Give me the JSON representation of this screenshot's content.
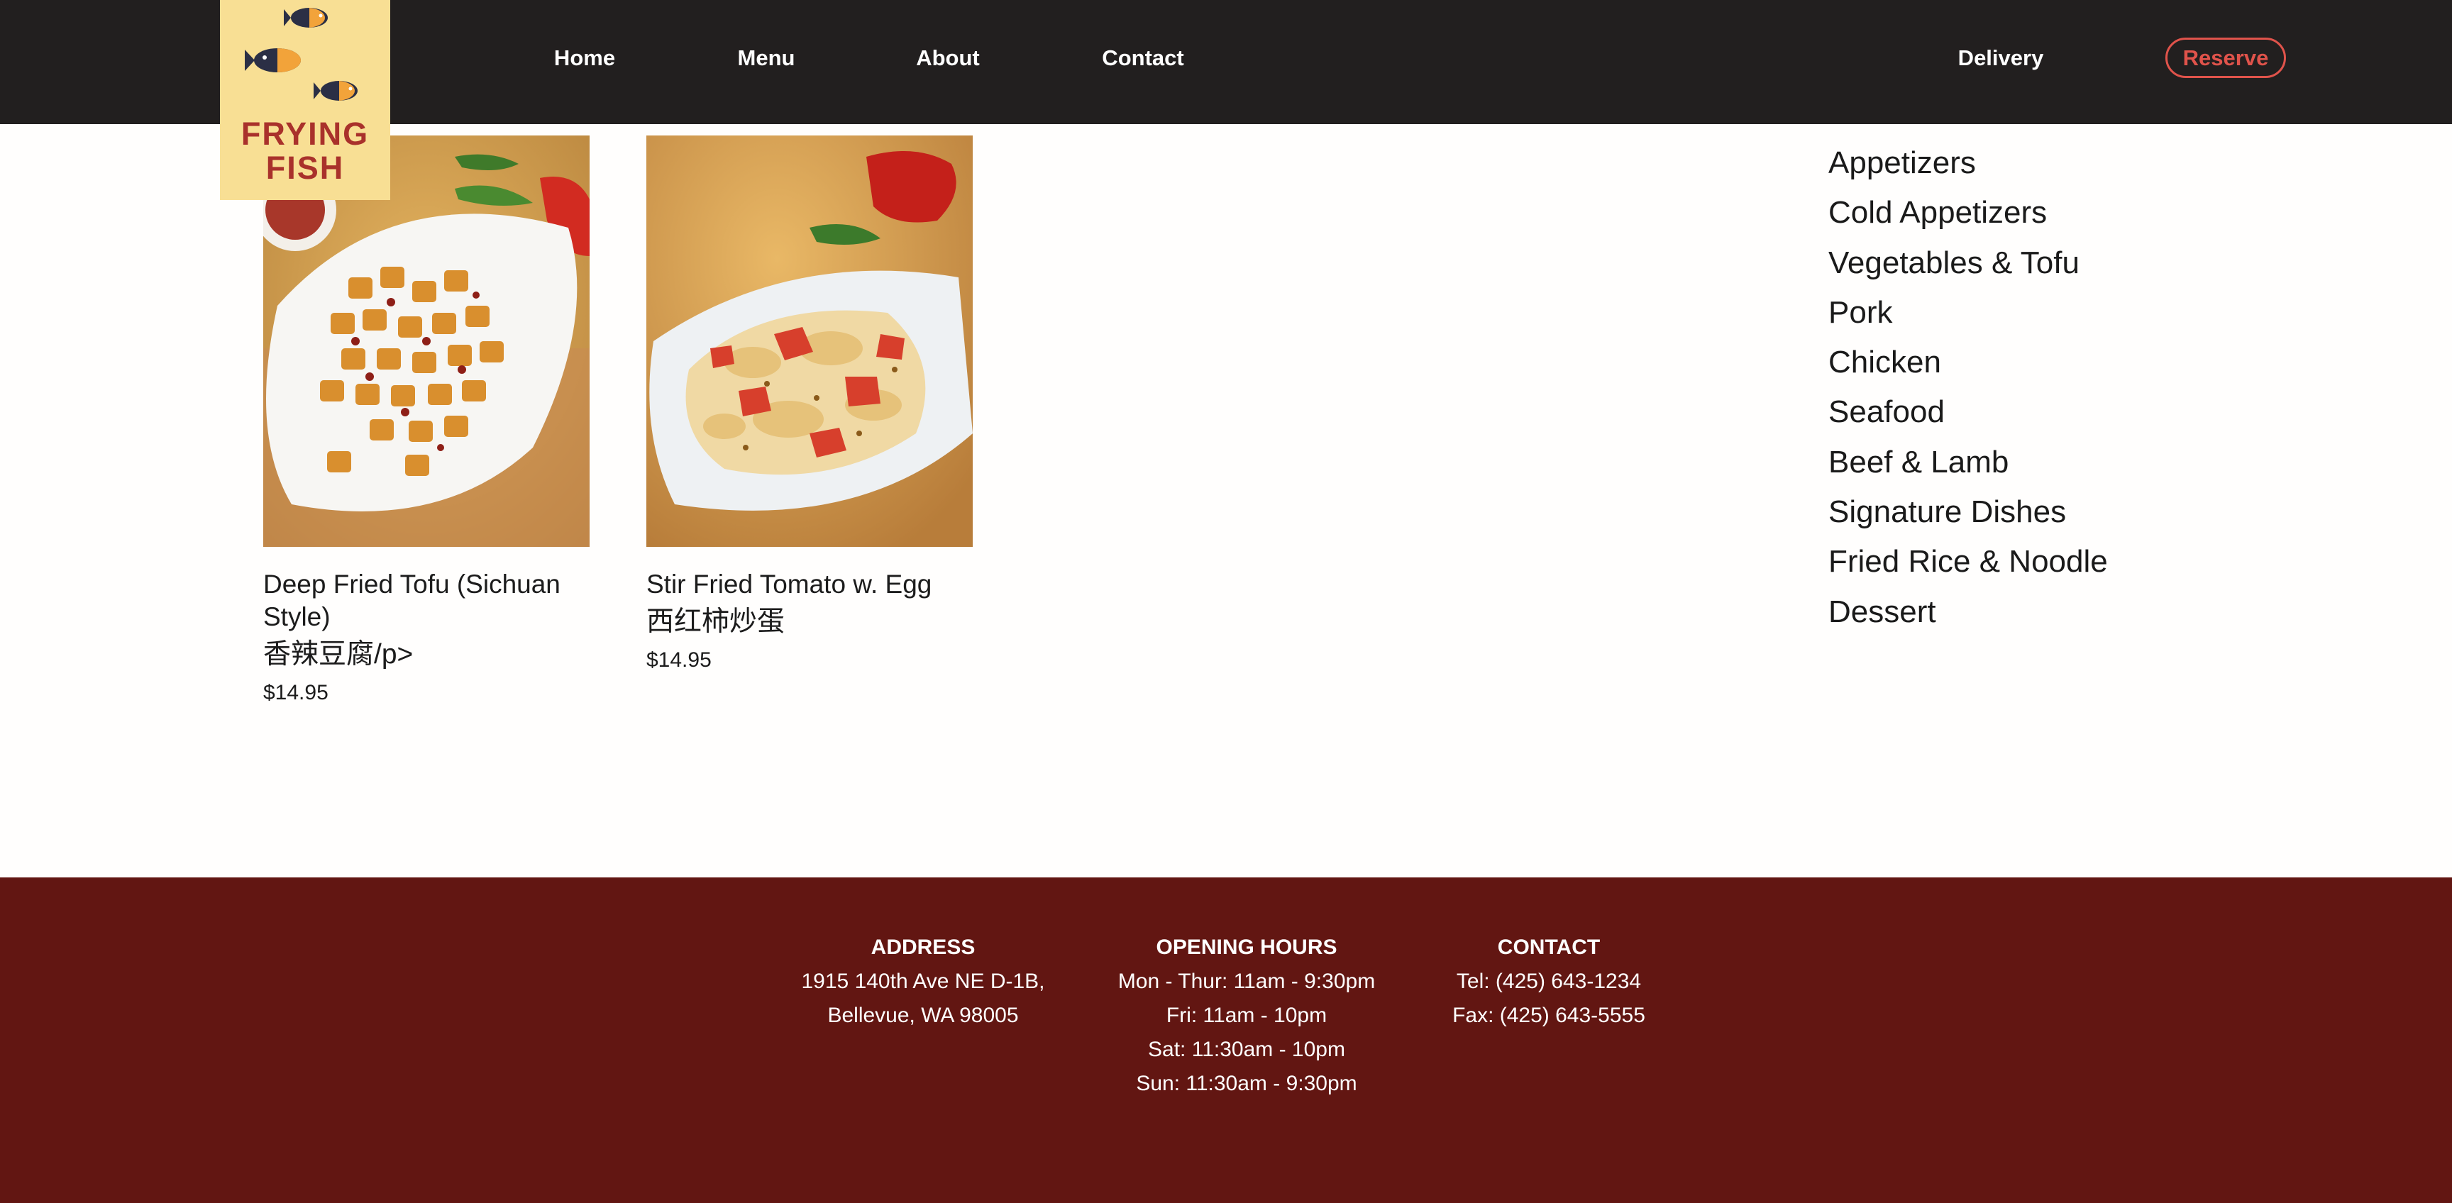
{
  "brand": {
    "logo_text_line1": "FRYING",
    "logo_text_line2": "FISH"
  },
  "nav": {
    "links": [
      "Home",
      "Menu",
      "About",
      "Contact"
    ],
    "delivery_label": "Delivery",
    "reserve_label": "Reserve"
  },
  "dishes": [
    {
      "name": "Deep Fried Tofu (Sichuan Style)",
      "name_cn": "香辣豆腐/p>",
      "price": "$14.95"
    },
    {
      "name": "Stir Fried Tomato w. Egg",
      "name_cn": "西红柿炒蛋",
      "price": "$14.95"
    }
  ],
  "categories": [
    "Appetizers",
    "Cold Appetizers",
    "Vegetables & Tofu",
    "Pork",
    "Chicken",
    "Seafood",
    "Beef & Lamb",
    "Signature Dishes",
    "Fried Rice & Noodle",
    "Dessert"
  ],
  "footer": {
    "address": {
      "heading": "ADDRESS",
      "lines": [
        "1915 140th Ave NE D-1B,",
        "Bellevue, WA 98005"
      ]
    },
    "hours": {
      "heading": "OPENING HOURS",
      "lines": [
        "Mon - Thur: 11am - 9:30pm",
        "Fri: 11am - 10pm",
        "Sat: 11:30am - 10pm",
        "Sun: 11:30am - 9:30pm"
      ]
    },
    "contact": {
      "heading": "CONTACT",
      "lines": [
        "Tel: (425) 643-1234",
        "Fax: (425) 643-5555"
      ]
    }
  },
  "colors": {
    "header_bg": "#221f1f",
    "footer_bg": "#621612",
    "logo_bg": "#f8df94",
    "logo_text": "#a9312b",
    "reserve_accent": "#e0534b"
  }
}
